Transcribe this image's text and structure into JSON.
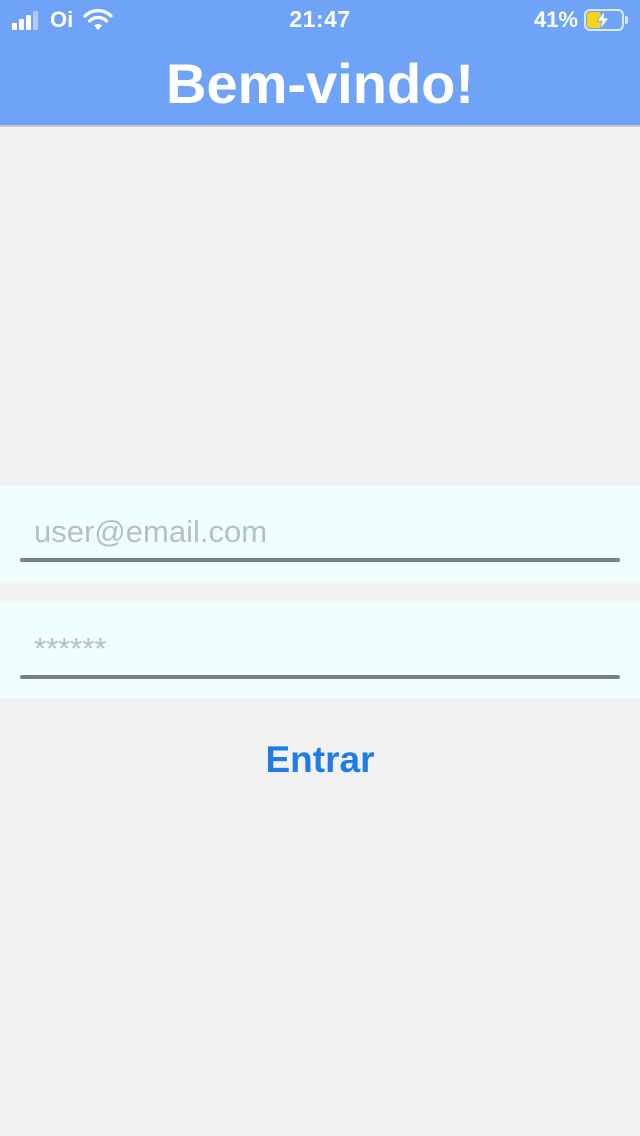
{
  "status_bar": {
    "carrier": "Oi",
    "time": "21:47",
    "battery_percent": "41%",
    "battery_level": 0.41,
    "signal_icon": "signal-bars-icon",
    "wifi_icon": "wifi-icon",
    "battery_icon": "battery-charging-icon"
  },
  "header": {
    "title": "Bem-vindo!"
  },
  "form": {
    "email": {
      "value": "",
      "placeholder": "user@email.com"
    },
    "password": {
      "value": "",
      "placeholder": "******"
    },
    "submit_label": "Entrar"
  },
  "colors": {
    "header_background": "#6ea3f7",
    "page_background": "#f2f2f2",
    "field_background": "#effffe",
    "button_text": "#1f7ce6",
    "battery_fill": "#f7d21b"
  }
}
